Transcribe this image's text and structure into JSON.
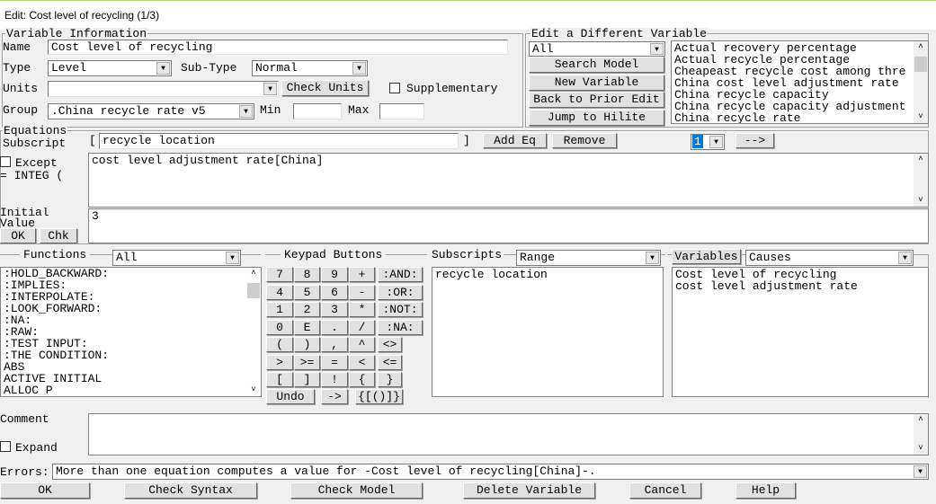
{
  "window": {
    "title": "Edit: Cost level of recycling (1/3)"
  },
  "variable_info": {
    "legend": "Variable Information",
    "name_label": "Name",
    "name": "Cost level of recycling",
    "type_label": "Type",
    "type": "Level",
    "subtype_label": "Sub-Type",
    "subtype": "Normal",
    "units_label": "Units",
    "units": "",
    "check_units": "Check Units",
    "supplementary_label": "Supplementary",
    "supplementary": false,
    "group_label": "Group",
    "group": ".China recycle rate v5",
    "min_label": "Min",
    "min": "",
    "max_label": "Max",
    "max": ""
  },
  "edit_different": {
    "legend": "Edit a Different Variable",
    "filter": "All",
    "buttons": [
      "Search Model",
      "New Variable",
      "Back to Prior Edit",
      "Jump to Hilite"
    ],
    "variables": [
      "Actual recovery percentage",
      "Actual recycle percentage",
      "Cheapeast recycle cost among thre",
      "China cost level adjustment rate",
      "China recycle capacity",
      "China recycle capacity adjustment",
      "China recycle rate"
    ]
  },
  "equations": {
    "legend": "Equations",
    "subscript_label": "Subscript",
    "bracket_open": "[",
    "subscript": "recycle location",
    "bracket_close": "]",
    "add_eq": "Add Eq",
    "remove": "Remove",
    "index": "1",
    "next": "-->",
    "except_label": "Except",
    "integ_label": "= INTEG (",
    "equation": "cost level adjustment rate[China]",
    "initial_label": "Initial Value",
    "initial": "3",
    "ok": "OK",
    "chk": "Chk"
  },
  "functions": {
    "label": "Functions",
    "filter": "All",
    "items": [
      ":HOLD_BACKWARD:",
      ":IMPLIES:",
      ":INTERPOLATE:",
      ":LOOK_FORWARD:",
      ":NA:",
      ":RAW:",
      ":TEST INPUT:",
      ":THE CONDITION:",
      "ABS",
      "ACTIVE INITIAL",
      "ALLOC P"
    ]
  },
  "keypad": {
    "label": "Keypad Buttons",
    "rows": [
      [
        "7",
        "8",
        "9",
        "+",
        ":AND:"
      ],
      [
        "4",
        "5",
        "6",
        "-",
        ":OR:"
      ],
      [
        "1",
        "2",
        "3",
        "*",
        ":NOT:"
      ],
      [
        "0",
        "E",
        ".",
        "/",
        ":NA:"
      ],
      [
        "(",
        ")",
        ",",
        "^",
        "<>"
      ],
      [
        ">",
        ">=",
        "=",
        "<",
        "<="
      ],
      [
        "[",
        "]",
        "!",
        "{",
        "}"
      ]
    ],
    "undo": "Undo",
    "arrow": "->",
    "brackets": "{[()]}"
  },
  "subscripts": {
    "label": "Subscripts",
    "filter": "Range",
    "items": [
      "recycle location"
    ]
  },
  "variables": {
    "button": "Variables",
    "filter": "Causes",
    "items": [
      "Cost level of recycling",
      "cost level adjustment rate"
    ]
  },
  "comment": {
    "label": "Comment",
    "expand_label": "Expand",
    "expand": false,
    "text": ""
  },
  "errors": {
    "label": "Errors:",
    "message": "More than one equation computes a value for -Cost level of recycling[China]-."
  },
  "bottom": [
    "OK",
    "Check Syntax",
    "Check Model",
    "Delete Variable",
    "Cancel",
    "Help"
  ]
}
